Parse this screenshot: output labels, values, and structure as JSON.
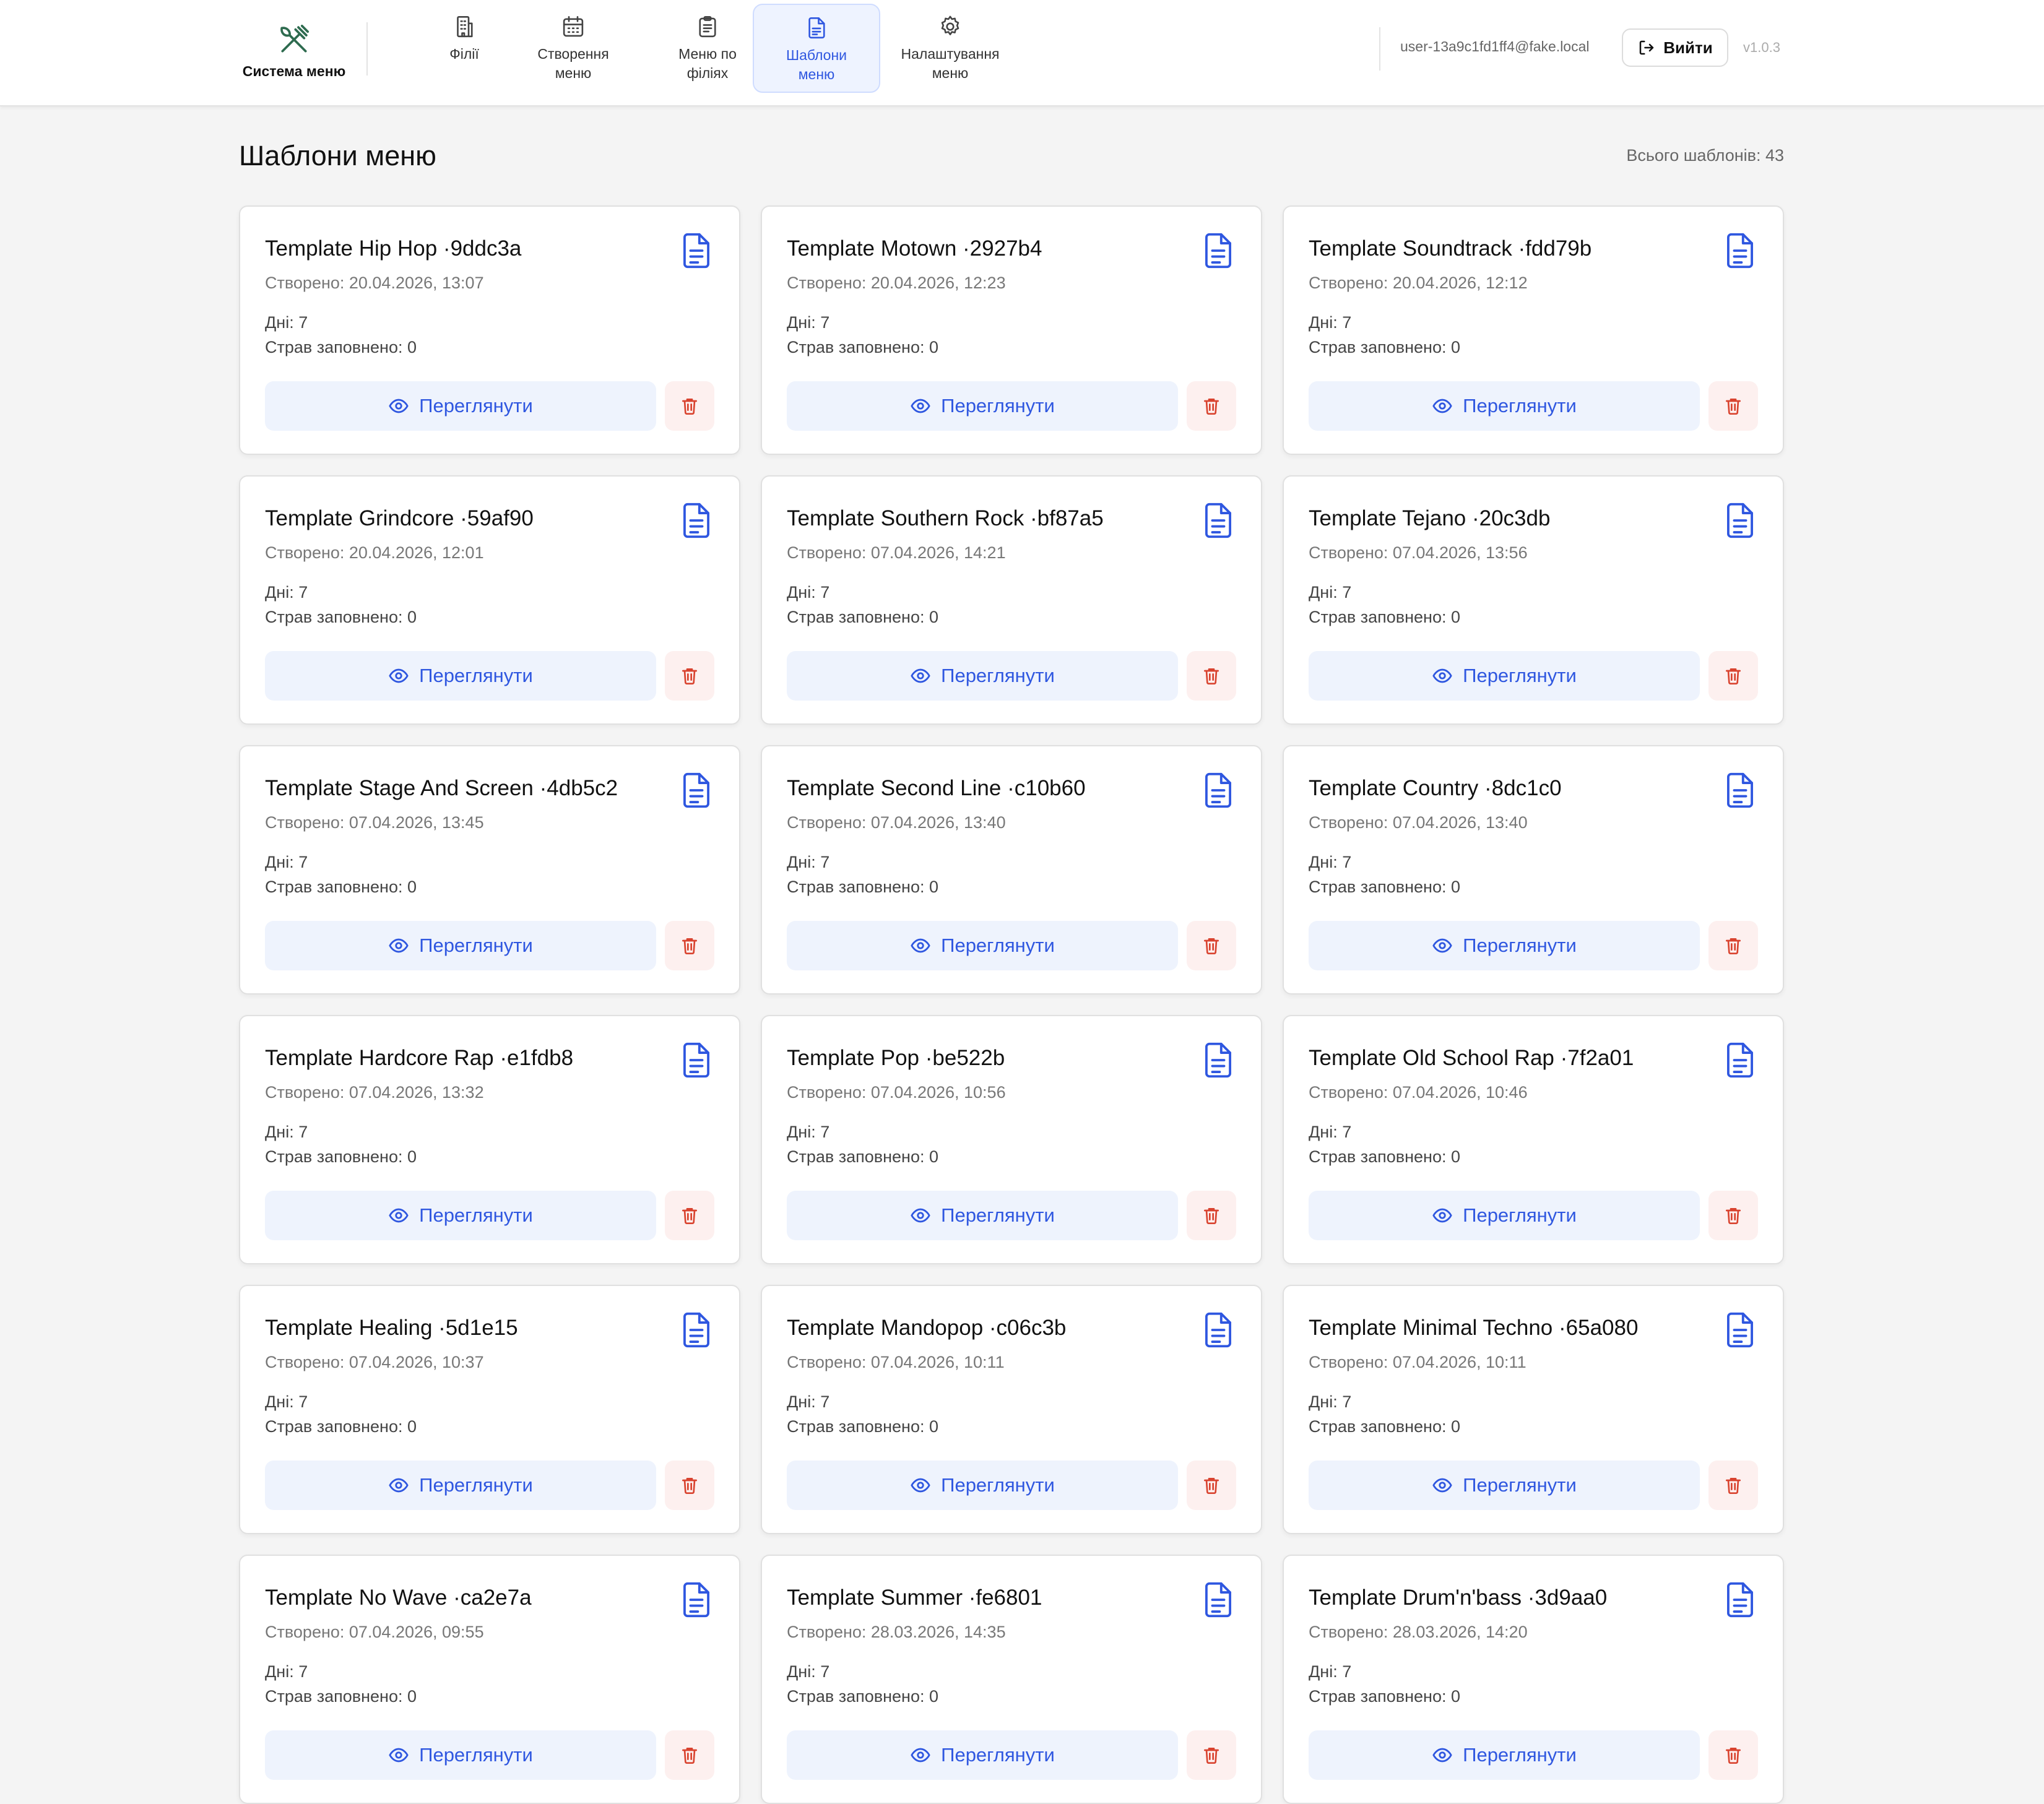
{
  "header": {
    "brand": "Система меню",
    "nav": [
      {
        "label": "Філії",
        "icon": "building-icon"
      },
      {
        "label": "Створення\nменю",
        "icon": "calendar-icon"
      },
      {
        "label": "Меню по\nфіліях",
        "icon": "clipboard-icon"
      },
      {
        "label": "Шаблони\nменю",
        "icon": "document-icon",
        "active": true
      },
      {
        "label": "Налаштування\nменю",
        "icon": "gear-icon"
      }
    ],
    "user_email": "user-13a9c1fd1ff4@fake.local",
    "logout_label": "Вийти",
    "version": "v1.0.3"
  },
  "page": {
    "title": "Шаблони меню",
    "total": "Всього шаблонів: 43"
  },
  "colors": {
    "accent": "#2f57e0",
    "brand_icon": "#2e6b4f",
    "danger": "#d9432f",
    "view_bg": "#eef3fd",
    "delete_bg": "#fdf0ef"
  },
  "card_labels": {
    "view": "Переглянути"
  },
  "templates": [
    {
      "title": "Template Hip Hop ·9ddc3a",
      "created": "Створено: 20.04.2026, 13:07",
      "days": "Дні: 7",
      "dishes": "Страв заповнено: 0"
    },
    {
      "title": "Template Motown ·2927b4",
      "created": "Створено: 20.04.2026, 12:23",
      "days": "Дні: 7",
      "dishes": "Страв заповнено: 0"
    },
    {
      "title": "Template Soundtrack ·fdd79b",
      "created": "Створено: 20.04.2026, 12:12",
      "days": "Дні: 7",
      "dishes": "Страв заповнено: 0"
    },
    {
      "title": "Template Grindcore ·59af90",
      "created": "Створено: 20.04.2026, 12:01",
      "days": "Дні: 7",
      "dishes": "Страв заповнено: 0"
    },
    {
      "title": "Template Southern Rock ·bf87a5",
      "created": "Створено: 07.04.2026, 14:21",
      "days": "Дні: 7",
      "dishes": "Страв заповнено: 0"
    },
    {
      "title": "Template Tejano ·20c3db",
      "created": "Створено: 07.04.2026, 13:56",
      "days": "Дні: 7",
      "dishes": "Страв заповнено: 0"
    },
    {
      "title": "Template Stage And Screen ·4db5c2",
      "created": "Створено: 07.04.2026, 13:45",
      "days": "Дні: 7",
      "dishes": "Страв заповнено: 0"
    },
    {
      "title": "Template Second Line ·c10b60",
      "created": "Створено: 07.04.2026, 13:40",
      "days": "Дні: 7",
      "dishes": "Страв заповнено: 0"
    },
    {
      "title": "Template Country ·8dc1c0",
      "created": "Створено: 07.04.2026, 13:40",
      "days": "Дні: 7",
      "dishes": "Страв заповнено: 0"
    },
    {
      "title": "Template Hardcore Rap ·e1fdb8",
      "created": "Створено: 07.04.2026, 13:32",
      "days": "Дні: 7",
      "dishes": "Страв заповнено: 0"
    },
    {
      "title": "Template Pop ·be522b",
      "created": "Створено: 07.04.2026, 10:56",
      "days": "Дні: 7",
      "dishes": "Страв заповнено: 0"
    },
    {
      "title": "Template Old School Rap ·7f2a01",
      "created": "Створено: 07.04.2026, 10:46",
      "days": "Дні: 7",
      "dishes": "Страв заповнено: 0"
    },
    {
      "title": "Template Healing ·5d1e15",
      "created": "Створено: 07.04.2026, 10:37",
      "days": "Дні: 7",
      "dishes": "Страв заповнено: 0"
    },
    {
      "title": "Template Mandopop ·c06c3b",
      "created": "Створено: 07.04.2026, 10:11",
      "days": "Дні: 7",
      "dishes": "Страв заповнено: 0"
    },
    {
      "title": "Template Minimal Techno ·65a080",
      "created": "Створено: 07.04.2026, 10:11",
      "days": "Дні: 7",
      "dishes": "Страв заповнено: 0"
    },
    {
      "title": "Template No Wave ·ca2e7a",
      "created": "Створено: 07.04.2026, 09:55",
      "days": "Дні: 7",
      "dishes": "Страв заповнено: 0"
    },
    {
      "title": "Template Summer ·fe6801",
      "created": "Створено: 28.03.2026, 14:35",
      "days": "Дні: 7",
      "dishes": "Страв заповнено: 0"
    },
    {
      "title": "Template Drum'n'bass ·3d9aa0",
      "created": "Створено: 28.03.2026, 14:20",
      "days": "Дні: 7",
      "dishes": "Страв заповнено: 0"
    }
  ]
}
